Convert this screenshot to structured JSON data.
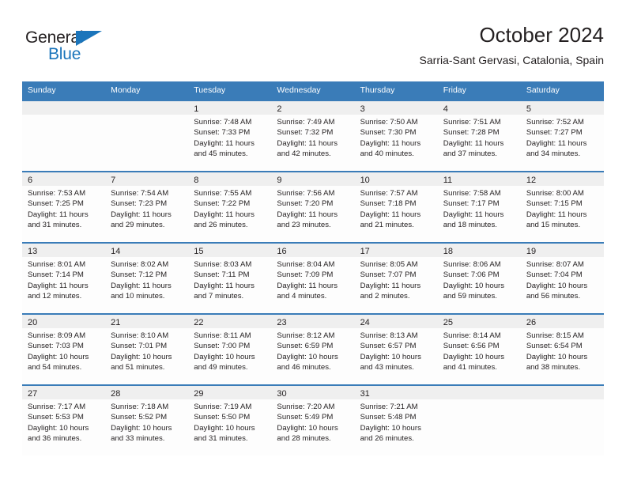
{
  "brand": {
    "name_part1": "General",
    "name_part2": "Blue",
    "triangle_color": "#1b75bb"
  },
  "header": {
    "title": "October 2024",
    "subtitle": "Sarria-Sant Gervasi, Catalonia, Spain"
  },
  "theme": {
    "header_bar": "#3a7cb8",
    "date_band": "#efefef",
    "text": "#231f20"
  },
  "weekdays": [
    {
      "label": "Sunday"
    },
    {
      "label": "Monday"
    },
    {
      "label": "Tuesday"
    },
    {
      "label": "Wednesday"
    },
    {
      "label": "Thursday"
    },
    {
      "label": "Friday"
    },
    {
      "label": "Saturday"
    }
  ],
  "weeks": [
    [
      {
        "day": "",
        "sunrise": "",
        "sunset": "",
        "daylight_line1": "",
        "daylight_line2": ""
      },
      {
        "day": "",
        "sunrise": "",
        "sunset": "",
        "daylight_line1": "",
        "daylight_line2": ""
      },
      {
        "day": "1",
        "sunrise": "Sunrise: 7:48 AM",
        "sunset": "Sunset: 7:33 PM",
        "daylight_line1": "Daylight: 11 hours",
        "daylight_line2": "and 45 minutes."
      },
      {
        "day": "2",
        "sunrise": "Sunrise: 7:49 AM",
        "sunset": "Sunset: 7:32 PM",
        "daylight_line1": "Daylight: 11 hours",
        "daylight_line2": "and 42 minutes."
      },
      {
        "day": "3",
        "sunrise": "Sunrise: 7:50 AM",
        "sunset": "Sunset: 7:30 PM",
        "daylight_line1": "Daylight: 11 hours",
        "daylight_line2": "and 40 minutes."
      },
      {
        "day": "4",
        "sunrise": "Sunrise: 7:51 AM",
        "sunset": "Sunset: 7:28 PM",
        "daylight_line1": "Daylight: 11 hours",
        "daylight_line2": "and 37 minutes."
      },
      {
        "day": "5",
        "sunrise": "Sunrise: 7:52 AM",
        "sunset": "Sunset: 7:27 PM",
        "daylight_line1": "Daylight: 11 hours",
        "daylight_line2": "and 34 minutes."
      }
    ],
    [
      {
        "day": "6",
        "sunrise": "Sunrise: 7:53 AM",
        "sunset": "Sunset: 7:25 PM",
        "daylight_line1": "Daylight: 11 hours",
        "daylight_line2": "and 31 minutes."
      },
      {
        "day": "7",
        "sunrise": "Sunrise: 7:54 AM",
        "sunset": "Sunset: 7:23 PM",
        "daylight_line1": "Daylight: 11 hours",
        "daylight_line2": "and 29 minutes."
      },
      {
        "day": "8",
        "sunrise": "Sunrise: 7:55 AM",
        "sunset": "Sunset: 7:22 PM",
        "daylight_line1": "Daylight: 11 hours",
        "daylight_line2": "and 26 minutes."
      },
      {
        "day": "9",
        "sunrise": "Sunrise: 7:56 AM",
        "sunset": "Sunset: 7:20 PM",
        "daylight_line1": "Daylight: 11 hours",
        "daylight_line2": "and 23 minutes."
      },
      {
        "day": "10",
        "sunrise": "Sunrise: 7:57 AM",
        "sunset": "Sunset: 7:18 PM",
        "daylight_line1": "Daylight: 11 hours",
        "daylight_line2": "and 21 minutes."
      },
      {
        "day": "11",
        "sunrise": "Sunrise: 7:58 AM",
        "sunset": "Sunset: 7:17 PM",
        "daylight_line1": "Daylight: 11 hours",
        "daylight_line2": "and 18 minutes."
      },
      {
        "day": "12",
        "sunrise": "Sunrise: 8:00 AM",
        "sunset": "Sunset: 7:15 PM",
        "daylight_line1": "Daylight: 11 hours",
        "daylight_line2": "and 15 minutes."
      }
    ],
    [
      {
        "day": "13",
        "sunrise": "Sunrise: 8:01 AM",
        "sunset": "Sunset: 7:14 PM",
        "daylight_line1": "Daylight: 11 hours",
        "daylight_line2": "and 12 minutes."
      },
      {
        "day": "14",
        "sunrise": "Sunrise: 8:02 AM",
        "sunset": "Sunset: 7:12 PM",
        "daylight_line1": "Daylight: 11 hours",
        "daylight_line2": "and 10 minutes."
      },
      {
        "day": "15",
        "sunrise": "Sunrise: 8:03 AM",
        "sunset": "Sunset: 7:11 PM",
        "daylight_line1": "Daylight: 11 hours",
        "daylight_line2": "and 7 minutes."
      },
      {
        "day": "16",
        "sunrise": "Sunrise: 8:04 AM",
        "sunset": "Sunset: 7:09 PM",
        "daylight_line1": "Daylight: 11 hours",
        "daylight_line2": "and 4 minutes."
      },
      {
        "day": "17",
        "sunrise": "Sunrise: 8:05 AM",
        "sunset": "Sunset: 7:07 PM",
        "daylight_line1": "Daylight: 11 hours",
        "daylight_line2": "and 2 minutes."
      },
      {
        "day": "18",
        "sunrise": "Sunrise: 8:06 AM",
        "sunset": "Sunset: 7:06 PM",
        "daylight_line1": "Daylight: 10 hours",
        "daylight_line2": "and 59 minutes."
      },
      {
        "day": "19",
        "sunrise": "Sunrise: 8:07 AM",
        "sunset": "Sunset: 7:04 PM",
        "daylight_line1": "Daylight: 10 hours",
        "daylight_line2": "and 56 minutes."
      }
    ],
    [
      {
        "day": "20",
        "sunrise": "Sunrise: 8:09 AM",
        "sunset": "Sunset: 7:03 PM",
        "daylight_line1": "Daylight: 10 hours",
        "daylight_line2": "and 54 minutes."
      },
      {
        "day": "21",
        "sunrise": "Sunrise: 8:10 AM",
        "sunset": "Sunset: 7:01 PM",
        "daylight_line1": "Daylight: 10 hours",
        "daylight_line2": "and 51 minutes."
      },
      {
        "day": "22",
        "sunrise": "Sunrise: 8:11 AM",
        "sunset": "Sunset: 7:00 PM",
        "daylight_line1": "Daylight: 10 hours",
        "daylight_line2": "and 49 minutes."
      },
      {
        "day": "23",
        "sunrise": "Sunrise: 8:12 AM",
        "sunset": "Sunset: 6:59 PM",
        "daylight_line1": "Daylight: 10 hours",
        "daylight_line2": "and 46 minutes."
      },
      {
        "day": "24",
        "sunrise": "Sunrise: 8:13 AM",
        "sunset": "Sunset: 6:57 PM",
        "daylight_line1": "Daylight: 10 hours",
        "daylight_line2": "and 43 minutes."
      },
      {
        "day": "25",
        "sunrise": "Sunrise: 8:14 AM",
        "sunset": "Sunset: 6:56 PM",
        "daylight_line1": "Daylight: 10 hours",
        "daylight_line2": "and 41 minutes."
      },
      {
        "day": "26",
        "sunrise": "Sunrise: 8:15 AM",
        "sunset": "Sunset: 6:54 PM",
        "daylight_line1": "Daylight: 10 hours",
        "daylight_line2": "and 38 minutes."
      }
    ],
    [
      {
        "day": "27",
        "sunrise": "Sunrise: 7:17 AM",
        "sunset": "Sunset: 5:53 PM",
        "daylight_line1": "Daylight: 10 hours",
        "daylight_line2": "and 36 minutes."
      },
      {
        "day": "28",
        "sunrise": "Sunrise: 7:18 AM",
        "sunset": "Sunset: 5:52 PM",
        "daylight_line1": "Daylight: 10 hours",
        "daylight_line2": "and 33 minutes."
      },
      {
        "day": "29",
        "sunrise": "Sunrise: 7:19 AM",
        "sunset": "Sunset: 5:50 PM",
        "daylight_line1": "Daylight: 10 hours",
        "daylight_line2": "and 31 minutes."
      },
      {
        "day": "30",
        "sunrise": "Sunrise: 7:20 AM",
        "sunset": "Sunset: 5:49 PM",
        "daylight_line1": "Daylight: 10 hours",
        "daylight_line2": "and 28 minutes."
      },
      {
        "day": "31",
        "sunrise": "Sunrise: 7:21 AM",
        "sunset": "Sunset: 5:48 PM",
        "daylight_line1": "Daylight: 10 hours",
        "daylight_line2": "and 26 minutes."
      },
      {
        "day": "",
        "sunrise": "",
        "sunset": "",
        "daylight_line1": "",
        "daylight_line2": ""
      },
      {
        "day": "",
        "sunrise": "",
        "sunset": "",
        "daylight_line1": "",
        "daylight_line2": ""
      }
    ]
  ]
}
